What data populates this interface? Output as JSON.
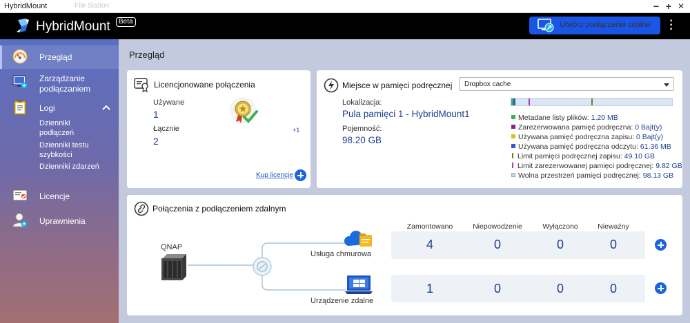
{
  "window": {
    "title": "HybridMount",
    "ghost_tab": "File Station",
    "minimize": "−",
    "maximize": "+",
    "close": "✕"
  },
  "header": {
    "app_name": "HybridMount",
    "badge": "Beta",
    "remote_button": "Utwórz podłączenie zdalne",
    "menu": "⋮"
  },
  "sidebar": {
    "items": [
      {
        "label": "Przegląd",
        "icon": "gauge-icon"
      },
      {
        "label": "Zarządzanie podłączaniem",
        "icon": "monitor-gear-icon"
      },
      {
        "label": "Logi",
        "icon": "clipboard-icon"
      },
      {
        "label": "Licencje",
        "icon": "license-certificate-icon"
      },
      {
        "label": "Uprawnienia",
        "icon": "user-gear-icon"
      }
    ],
    "manage_line1": "Zarządzanie",
    "manage_line2": "podłączaniem",
    "log_sub": [
      {
        "line1": "Dzienniki",
        "line2": "podłączeń"
      },
      {
        "line1": "Dzienniki testu",
        "line2": "szybkości"
      },
      {
        "line1": "Dzienniki zdarzeń",
        "line2": ""
      }
    ]
  },
  "main": {
    "page_title": "Przegląd",
    "licenses": {
      "title": "Licencjonowane połączenia",
      "used_label": "Używane",
      "used_value": "1",
      "total_label": "Łącznie",
      "total_value": "2",
      "total_delta": "+1",
      "buy_link": "Kup licencje"
    },
    "cache": {
      "title": "Miejsce w pamięci podręcznej",
      "select_value": "Dropbox cache",
      "location_label": "Lokalizacja:",
      "location_value": "Pula pamięci 1 - HybridMount1",
      "capacity_label": "Pojemność:",
      "capacity_value": "98.20 GB",
      "legend": [
        {
          "label": "Metadane listy plików:",
          "value": "1.20 MB",
          "color": "#2fb84a",
          "kind": "swatch"
        },
        {
          "label": "Zarezerwowana pamięć podręczna:",
          "value": "0 Bajt(y)",
          "color": "#7b2a8f",
          "kind": "swatch"
        },
        {
          "label": "Używana pamięć podręczna zapisu:",
          "value": "0 Bajt(y)",
          "color": "#d8c21a",
          "kind": "swatch"
        },
        {
          "label": "Używana pamięć podręczna odczytu:",
          "value": "61.36 MB",
          "color": "#2f58c8",
          "kind": "swatch"
        },
        {
          "label": "Limit pamięci podręcznej zapisu:",
          "value": "49.10 GB",
          "color": "#7a7a24",
          "kind": "tick"
        },
        {
          "label": "Limit zarezerwowanej pamięci podręcznej:",
          "value": "9.82 GB",
          "color": "#a43bc0",
          "kind": "tick"
        },
        {
          "label": "Wolna przestrzeń pamięci podręcznej:",
          "value": "98.13 GB",
          "color": "#c9d6ea",
          "kind": "swatch"
        }
      ]
    },
    "remote": {
      "title": "Połączenia z podłączeniem zdalnym",
      "source_label": "QNAP",
      "cloud_label": "Usługa chmurowa",
      "device_label": "Urządzenie zdalne",
      "columns": [
        "Zamontowano",
        "Niepowodzenie",
        "Wyłączono",
        "Nieważny"
      ],
      "rows": [
        {
          "values": [
            "4",
            "0",
            "0",
            "0"
          ]
        },
        {
          "values": [
            "1",
            "0",
            "0",
            "0"
          ]
        }
      ]
    }
  }
}
